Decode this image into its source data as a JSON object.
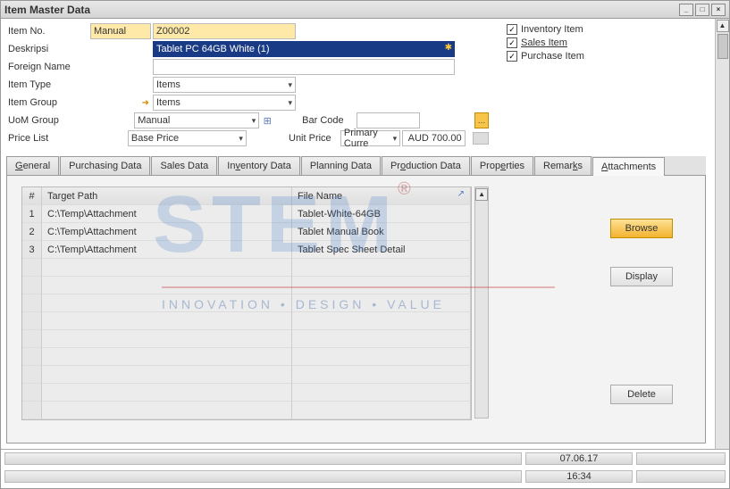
{
  "window": {
    "title": "Item Master Data"
  },
  "header": {
    "itemno_label": "Item No.",
    "itemno_mode": "Manual",
    "itemno_value": "Z00002",
    "desc_label": "Deskripsi",
    "desc_value": "Tablet PC 64GB White (1)",
    "foreign_label": "Foreign Name",
    "foreign_value": "",
    "itemtype_label": "Item Type",
    "itemtype_value": "Items",
    "itemgroup_label": "Item Group",
    "itemgroup_value": "Items",
    "uom_label": "UoM Group",
    "uom_value": "Manual",
    "pricelist_label": "Price List",
    "pricelist_value": "Base Price",
    "barcode_label": "Bar Code",
    "barcode_value": "",
    "unitprice_label": "Unit Price",
    "unitprice_curr": "Primary Curre",
    "unitprice_value": "AUD 700.00"
  },
  "checks": {
    "inventory": "Inventory Item",
    "sales": "Sales Item",
    "purchase": "Purchase Item"
  },
  "tabs": {
    "general": "General",
    "purchasing": "Purchasing Data",
    "sales": "Sales Data",
    "inventory": "Inventory Data",
    "planning": "Planning Data",
    "production": "Production Data",
    "properties": "Properties",
    "remarks": "Remarks",
    "attachments": "Attachments"
  },
  "grid": {
    "col_num": "#",
    "col_path": "Target Path",
    "col_file": "File Name",
    "rows": [
      {
        "n": "1",
        "path": "C:\\Temp\\Attachment",
        "file": "Tablet-White-64GB"
      },
      {
        "n": "2",
        "path": "C:\\Temp\\Attachment",
        "file": "Tablet Manual Book"
      },
      {
        "n": "3",
        "path": "C:\\Temp\\Attachment",
        "file": "Tablet Spec Sheet Detail"
      }
    ]
  },
  "buttons": {
    "browse": "Browse",
    "display": "Display",
    "delete": "Delete"
  },
  "footer": {
    "date": "07.06.17",
    "time": "16:34"
  },
  "watermark": {
    "big": "STEM",
    "sub": "INNOVATION  •  DESIGN  •  VALUE"
  }
}
